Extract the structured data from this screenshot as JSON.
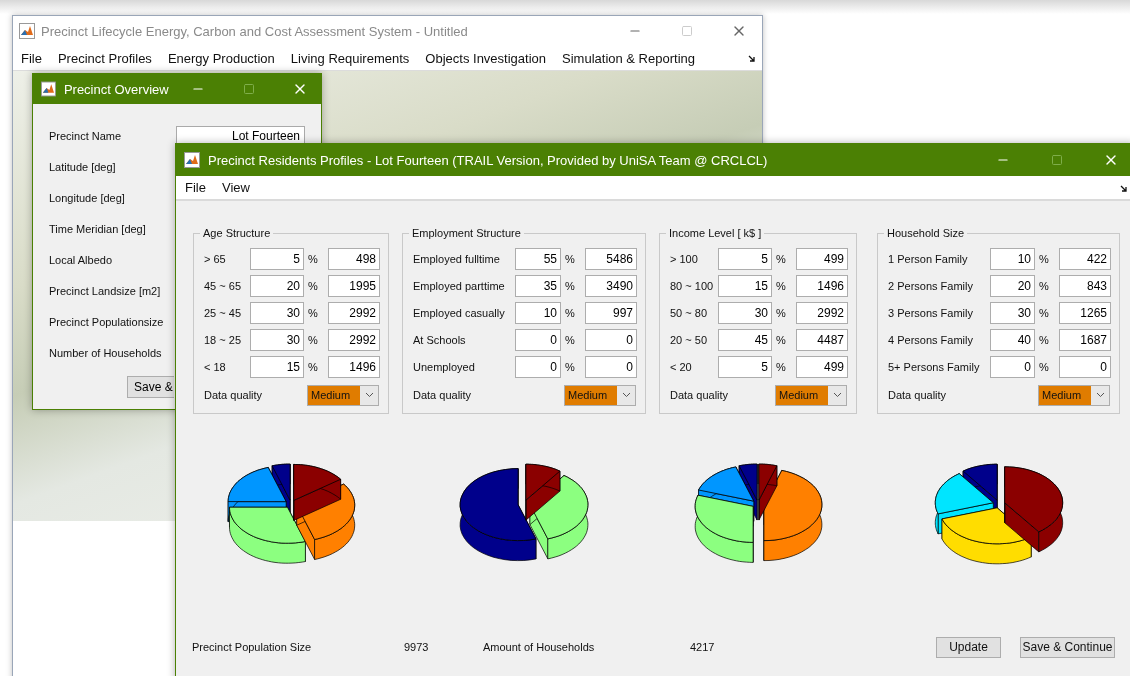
{
  "main_window": {
    "title": "Precinct Lifecycle Energy, Carbon and Cost Assessment System  -  Untitled",
    "menu": [
      "File",
      "Precinct Profiles",
      "Energy Production",
      "Living Requirements",
      "Objects Investigation",
      "Simulation & Reporting"
    ]
  },
  "overview_window": {
    "title": "Precinct Overview",
    "fields": [
      {
        "label": "Precinct Name",
        "value": "Lot Fourteen"
      },
      {
        "label": "Latitude [deg]"
      },
      {
        "label": "Longitude [deg]"
      },
      {
        "label": "Time Meridian [deg]"
      },
      {
        "label": "Local Albedo"
      },
      {
        "label": "Precinct Landsize [m2]"
      },
      {
        "label": "Precinct Populationsize"
      },
      {
        "label": "Number of Households"
      }
    ],
    "button": "Save &"
  },
  "residents_window": {
    "title": "Precinct Residents Profiles  -  Lot Fourteen (TRAIL Version, Provided by UniSA Team @ CRCLCL)",
    "menu": [
      "File",
      "View"
    ],
    "groups": [
      {
        "title": "Age Structure",
        "rows": [
          {
            "label": "> 65",
            "percent": "5",
            "unit": "%",
            "count": "498"
          },
          {
            "label": "45 ~ 65",
            "percent": "20",
            "unit": "%",
            "count": "1995"
          },
          {
            "label": "25 ~ 45",
            "percent": "30",
            "unit": "%",
            "count": "2992"
          },
          {
            "label": "18 ~ 25",
            "percent": "30",
            "unit": "%",
            "count": "2992"
          },
          {
            "label": "< 18",
            "percent": "15",
            "unit": "%",
            "count": "1496"
          }
        ],
        "quality_label": "Data quality",
        "quality": "Medium"
      },
      {
        "title": "Employment Structure",
        "rows": [
          {
            "label": "Employed fulltime",
            "percent": "55",
            "unit": "%",
            "count": "5486"
          },
          {
            "label": "Employed parttime",
            "percent": "35",
            "unit": "%",
            "count": "3490"
          },
          {
            "label": "Employed casually",
            "percent": "10",
            "unit": "%",
            "count": "997"
          },
          {
            "label": "At Schools",
            "percent": "0",
            "unit": "%",
            "count": "0"
          },
          {
            "label": "Unemployed",
            "percent": "0",
            "unit": "%",
            "count": "0"
          }
        ],
        "quality_label": "Data quality",
        "quality": "Medium"
      },
      {
        "title": "Income Level [ k$ ]",
        "rows": [
          {
            "label": "> 100",
            "percent": "5",
            "unit": "%",
            "count": "499"
          },
          {
            "label": "80 ~ 100",
            "percent": "15",
            "unit": "%",
            "count": "1496"
          },
          {
            "label": "50 ~ 80",
            "percent": "30",
            "unit": "%",
            "count": "2992"
          },
          {
            "label": "20 ~ 50",
            "percent": "45",
            "unit": "%",
            "count": "4487"
          },
          {
            "label": "< 20",
            "percent": "5",
            "unit": "%",
            "count": "499"
          }
        ],
        "quality_label": "Data quality",
        "quality": "Medium"
      },
      {
        "title": "Household Size",
        "rows": [
          {
            "label": "1 Person Family",
            "percent": "10",
            "unit": "%",
            "count": "422"
          },
          {
            "label": "2 Persons Family",
            "percent": "20",
            "unit": "%",
            "count": "843"
          },
          {
            "label": "3 Persons Family",
            "percent": "30",
            "unit": "%",
            "count": "1265"
          },
          {
            "label": "4 Persons Family",
            "percent": "40",
            "unit": "%",
            "count": "1687"
          },
          {
            "label": "5+ Persons Family",
            "percent": "0",
            "unit": "%",
            "count": "0"
          }
        ],
        "quality_label": "Data quality",
        "quality": "Medium"
      }
    ],
    "summary": [
      {
        "label": "Precinct Population Size",
        "value": "9973"
      },
      {
        "label": "Amount of Households",
        "value": "4217"
      }
    ],
    "buttons": [
      "Update",
      "Save & Continue"
    ]
  }
}
